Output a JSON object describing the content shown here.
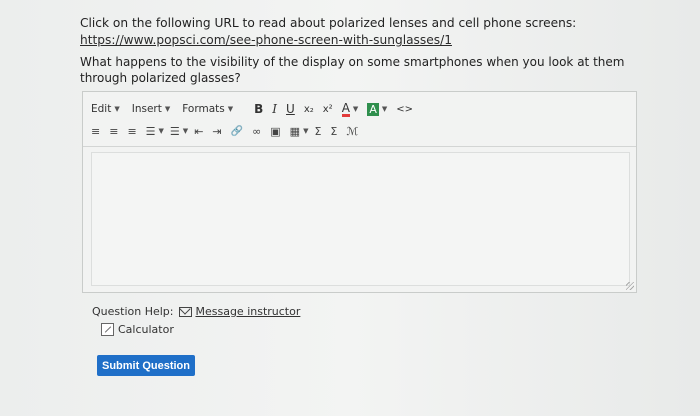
{
  "intro": {
    "text": "Click on the following URL to read about polarized lenses and cell phone screens:",
    "url": "https://www.popsci.com/see-phone-screen-with-sunglasses/1"
  },
  "question": {
    "text": "What happens to the visibility of the display on some smartphones when you look at them through polarized glasses?"
  },
  "editor": {
    "menu": [
      "Edit",
      "Insert",
      "Formats"
    ],
    "toolbar1_buttons": [
      {
        "name": "bold-button",
        "glyph": "B"
      },
      {
        "name": "italic-button",
        "glyph": "I"
      },
      {
        "name": "underline-button",
        "glyph": "U"
      },
      {
        "name": "subscript-button",
        "glyph": "x₂"
      },
      {
        "name": "superscript-button",
        "glyph": "x²"
      },
      {
        "name": "text-color-button",
        "glyph": "A"
      },
      {
        "name": "background-color-button",
        "glyph": "A"
      },
      {
        "name": "source-code-button",
        "glyph": "<>"
      }
    ],
    "toolbar2_buttons": [
      {
        "name": "align-left-button",
        "glyph": "≡"
      },
      {
        "name": "align-center-button",
        "glyph": "≡"
      },
      {
        "name": "align-right-button",
        "glyph": "≡"
      },
      {
        "name": "bullet-list-button",
        "glyph": "☰"
      },
      {
        "name": "numbered-list-button",
        "glyph": "☰"
      },
      {
        "name": "outdent-button",
        "glyph": "⇤"
      },
      {
        "name": "indent-button",
        "glyph": "⇥"
      },
      {
        "name": "link-button",
        "glyph": "🔗"
      },
      {
        "name": "unlink-button",
        "glyph": "∞"
      },
      {
        "name": "image-button",
        "glyph": "▣"
      },
      {
        "name": "table-button",
        "glyph": "▦"
      },
      {
        "name": "sum-button",
        "glyph": "Σ"
      },
      {
        "name": "sigma-button",
        "glyph": "Σ"
      },
      {
        "name": "math-button",
        "glyph": "ℳ"
      }
    ]
  },
  "help": {
    "label": "Question Help:",
    "message_link": "Message instructor",
    "calculator": "Calculator"
  },
  "submit_label": "Submit Question",
  "colors": {
    "submit_bg": "#1f6fc8",
    "text_color_swatch": "#e23b3b",
    "bg_color_swatch": "#2f8f4d"
  }
}
